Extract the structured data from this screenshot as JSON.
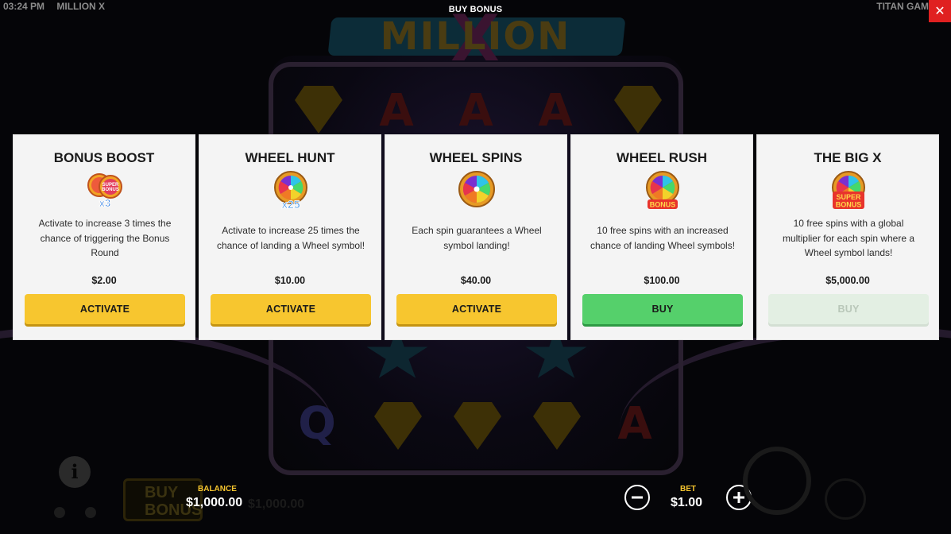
{
  "status_bar": {
    "time": "03:24 PM",
    "game_name": "MILLION X",
    "provider": "TITAN GAM",
    "modal_title": "BUY BONUS",
    "close_label": "✕"
  },
  "background": {
    "logo": "MILLION",
    "logo_x": "X",
    "buy_bonus_line1": "BUY",
    "buy_bonus_line2": "BONUS",
    "ghost_balance": "$1,000.00",
    "letter_a": "A",
    "letter_q": "Q"
  },
  "cards": [
    {
      "title": "BONUS BOOST",
      "icon": "bonus-boost-x3-icon",
      "icon_text": "x3",
      "description": "Activate to increase 3 times the chance of triggering the Bonus Round",
      "price": "$2.00",
      "button_label": "ACTIVATE",
      "button_state": "enabled"
    },
    {
      "title": "WHEEL HUNT",
      "icon": "wheel-x25-icon",
      "icon_text": "x25",
      "description": "Activate to increase 25 times the chance of landing a Wheel symbol!",
      "price": "$10.00",
      "button_label": "ACTIVATE",
      "button_state": "enabled"
    },
    {
      "title": "WHEEL SPINS",
      "icon": "wheel-icon",
      "description": "Each spin guarantees a Wheel symbol landing!",
      "price": "$40.00",
      "button_label": "ACTIVATE",
      "button_state": "enabled"
    },
    {
      "title": "WHEEL RUSH",
      "icon": "wheel-bonus-icon",
      "icon_text": "BONUS",
      "description": "10 free spins with an increased chance of landing Wheel symbols!",
      "price": "$100.00",
      "button_label": "BUY",
      "button_state": "enabled"
    },
    {
      "title": "THE BIG X",
      "icon": "wheel-super-bonus-icon",
      "icon_text": "SUPER BONUS",
      "description": "10 free spins with a global multiplier for each spin where a Wheel symbol lands!",
      "price": "$5,000.00",
      "button_label": "BUY",
      "button_state": "disabled"
    }
  ],
  "bottom_bar": {
    "balance_label": "BALANCE",
    "balance_value": "$1,000.00",
    "bet_label": "BET",
    "bet_value": "$1.00",
    "info_label": "i"
  },
  "colors": {
    "accent_yellow": "#f7c62f",
    "buy_green": "#55d06b",
    "disabled_green": "#e3efe3",
    "close_red": "#e02020",
    "card_bg": "#f4f4f4"
  }
}
